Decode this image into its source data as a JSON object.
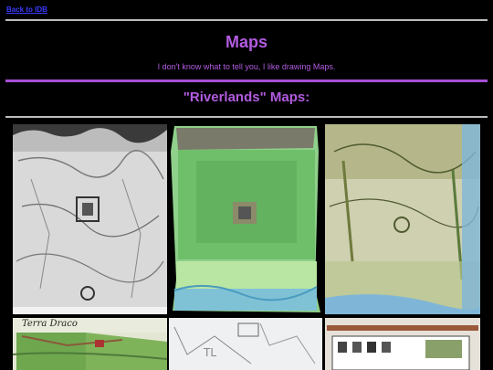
{
  "nav": {
    "back_label": "Back to IDB"
  },
  "header": {
    "title": "Maps",
    "subtitle": "I don't know what to tell you, I like drawing Maps."
  },
  "section": {
    "title": "\"Riverlands\" Maps:"
  },
  "gallery": {
    "items": [
      {
        "name": "map-1",
        "tone": "grayscale"
      },
      {
        "name": "map-2",
        "tone": "green"
      },
      {
        "name": "map-3",
        "tone": "olive-blue"
      },
      {
        "name": "map-4",
        "label": "Terra Draco"
      },
      {
        "name": "map-5",
        "tone": "pale-sketch"
      },
      {
        "name": "map-6",
        "tone": "city-sketch"
      }
    ]
  },
  "colors": {
    "background": "#000000",
    "accent": "#b25be0",
    "link": "#3a3cff",
    "rule_gray": "#bdbdbd",
    "rule_purple": "#a64fd6"
  }
}
